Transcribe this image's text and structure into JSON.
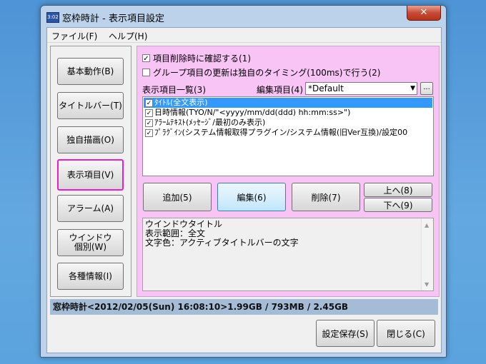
{
  "window": {
    "icon_text": "3:02",
    "title": "窓枠時計 - 表示項目設定",
    "close_glyph": "✕"
  },
  "menu": {
    "file": "ファイル(F)",
    "help": "ヘルプ(H)"
  },
  "sidebar": {
    "items": [
      {
        "label": "基本動作(B)"
      },
      {
        "label": "タイトルバー(T)"
      },
      {
        "label": "独自描画(O)"
      },
      {
        "label": "表示項目(V)"
      },
      {
        "label": "アラーム(A)"
      },
      {
        "label": "ウインドウ個別(W)"
      },
      {
        "label": "各種情報(I)"
      }
    ],
    "active_index": 3
  },
  "panel": {
    "confirm_delete": {
      "label": "項目削除時に確認する(1)",
      "checked": true
    },
    "group_update": {
      "label": "グループ項目の更新は独自のタイミング(100ms)で行う(2)",
      "checked": false
    },
    "list_label": "表示項目一覧(3)",
    "edit_label": "編集項目(4)",
    "combo_value": "*Default",
    "combo_arrow": "▼",
    "dots_label": "...",
    "items": [
      {
        "text": "ﾀｲﾄﾙ(全文表示)",
        "checked": true,
        "selected": true
      },
      {
        "text": "日時情報(TYO/N/\"<yyyy/mm/dd(ddd) hh:mm:ss>\")",
        "checked": true,
        "selected": false
      },
      {
        "text": "ｱﾗｰﾑﾃｷｽﾄ(ﾒｯｾｰｼﾞ/最初のみ表示)",
        "checked": true,
        "selected": false
      },
      {
        "text": "ﾌﾟﾗｸﾞｲﾝ(システム情報取得プラグイン/システム情報(旧Ver互換)/設定00",
        "checked": true,
        "selected": false
      }
    ],
    "check_mark": "✓",
    "add_label": "追加(5)",
    "edit_button": "編集(6)",
    "delete_label": "削除(7)",
    "up_label": "上へ(8)",
    "down_label": "下へ(9)",
    "description": {
      "line1": "ウインドウタイトル",
      "line2": "表示範囲：全文",
      "line3": "文字色：アクティブタイトルバーの文字"
    },
    "scroll_up": "▲",
    "scroll_down": "▼"
  },
  "status": {
    "text": "窓枠時計<2012/02/05(Sun) 16:08:10>1.99GB / 793MB / 2.45GB"
  },
  "footer": {
    "save_label": "設定保存(S)",
    "close_label": "閉じる(C)"
  }
}
